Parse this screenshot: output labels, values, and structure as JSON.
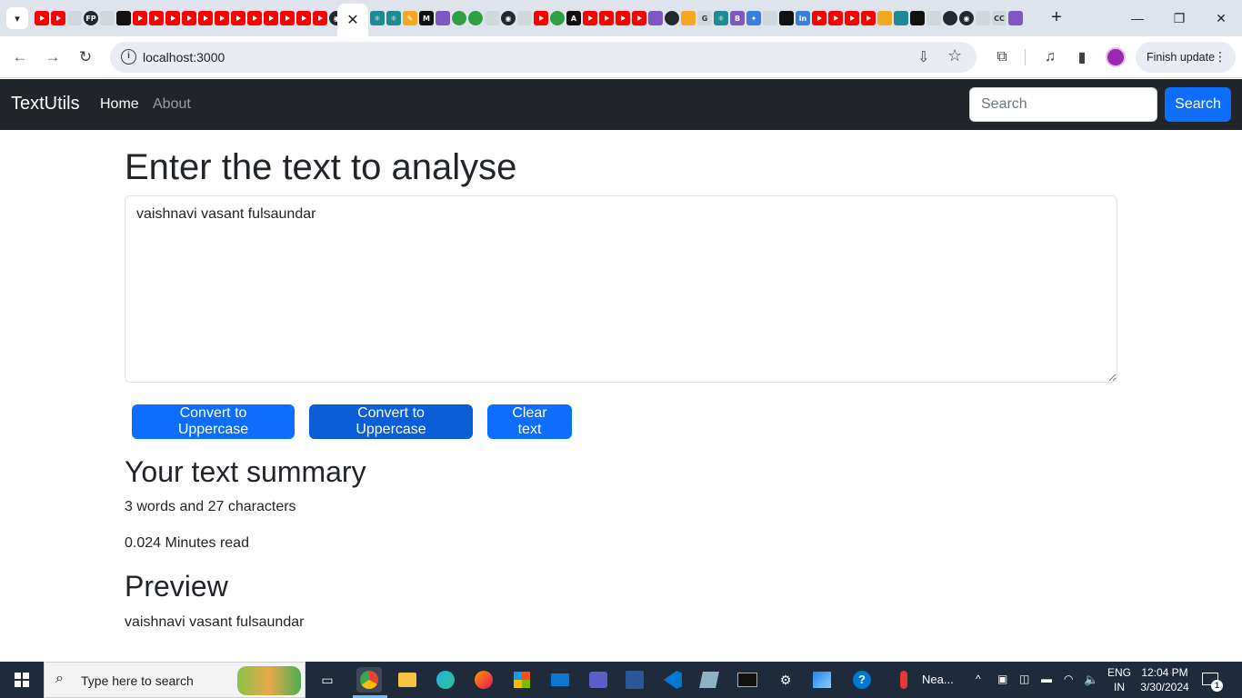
{
  "browser": {
    "url": "localhost:3000",
    "finish_update_label": "Finish update",
    "tab_close_glyph": "✕",
    "new_tab_glyph": "+",
    "tab_icon_labels": [
      "FP",
      "A",
      "G",
      "B",
      "in",
      "CC"
    ],
    "win_controls": [
      "—",
      "❐",
      "✕"
    ]
  },
  "navbar": {
    "brand": "TextUtils",
    "links": [
      "Home",
      "About"
    ],
    "search_placeholder": "Search",
    "search_button": "Search"
  },
  "main": {
    "heading": "Enter the text to analyse",
    "textarea_value": "vaishnavi vasant fulsaundar",
    "buttons": [
      "Convert to Uppercase",
      "Convert to Uppercase",
      "Clear text"
    ],
    "summary_title": "Your text summary",
    "summary_counts": "3 words and 27 characters",
    "read_time": "0.024 Minutes read",
    "preview_title": "Preview",
    "preview_text": "vaishnavi vasant fulsaundar"
  },
  "taskbar": {
    "search_placeholder": "Type here to search",
    "weather_label": "Nea...",
    "lang_top": "ENG",
    "lang_bottom": "IN",
    "time": "12:04 PM",
    "date": "3/30/2024",
    "notification_count": "1"
  },
  "colors": {
    "navbar_bg": "#212529",
    "primary": "#0d6efd",
    "primary_focus": "#0b5ed7",
    "taskbar_bg": "#1f2b3b"
  }
}
